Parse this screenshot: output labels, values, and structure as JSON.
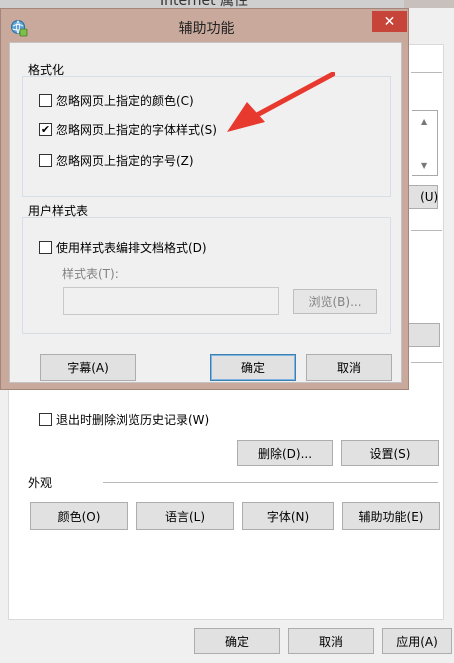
{
  "background_window": {
    "title": "Internet 属性",
    "partial_button_1": "     (U)",
    "privacy": {
      "checkbox_label": "退出时删除浏览历史记录(W)",
      "checked": false
    },
    "history_buttons": {
      "delete": "删除(D)...",
      "settings": "设置(S)"
    },
    "appearance": {
      "section_title": "外观",
      "buttons": {
        "colors": "颜色(O)",
        "languages": "语言(L)",
        "fonts": "字体(N)",
        "accessibility": "辅助功能(E)"
      }
    },
    "footer": {
      "ok": "确定",
      "cancel": "取消",
      "apply": "应用(A)"
    }
  },
  "dialog": {
    "title": "辅助功能",
    "close_glyph": "✕",
    "formatting": {
      "group_title": "格式化",
      "options": [
        {
          "label": "忽略网页上指定的颜色(C)",
          "checked": false
        },
        {
          "label": "忽略网页上指定的字体样式(S)",
          "checked": true
        },
        {
          "label": "忽略网页上指定的字号(Z)",
          "checked": false
        }
      ]
    },
    "user_stylesheet": {
      "group_title": "用户样式表",
      "checkbox_label": "使用样式表编排文档格式(D)",
      "checked": false,
      "field_label": "样式表(T):",
      "field_value": "",
      "browse_button": "浏览(B)..."
    },
    "buttons": {
      "captions": "字幕(A)",
      "ok": "确定",
      "cancel": "取消"
    }
  },
  "annotation": {
    "arrow_color": "#e8392f"
  },
  "colors": {
    "dialog_frame": "#c9a99c",
    "close_button": "#c7443a",
    "dialog_body": "#f0f0f0"
  }
}
